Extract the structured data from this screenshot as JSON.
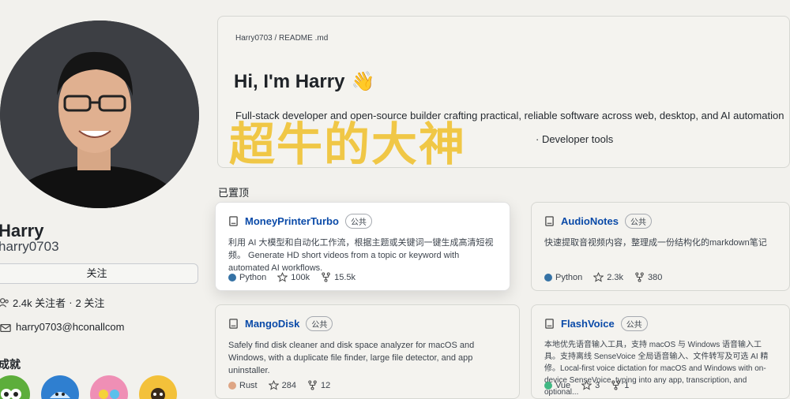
{
  "profile": {
    "name": "Harry",
    "login": "harry0703",
    "follow_label": "关注",
    "followers": "2.4k 关注者",
    "sep": "·",
    "following": "2 关注",
    "email": "harry0703@hconallcom",
    "achievements_title": "成就"
  },
  "readme": {
    "breadcrumb": "Harry0703 / README .md",
    "greeting": "Hi, I'm Harry",
    "greeting_emoji": "👋",
    "bio": "Full-stack developer and open-source builder crafting practical, reliable software across web, desktop, and AI automation",
    "extra": "· Developer tools"
  },
  "overlay_text": "超牛的大神",
  "pinned": {
    "title": "已置顶",
    "repos": [
      {
        "name": "MoneyPrinterTurbo",
        "visibility": "公共",
        "description": "利用 AI 大模型和自动化工作流，根据主题或关键词一键生成高清短视频。 Generate HD short videos from a topic or keyword with automated AI workflows.",
        "language": "Python",
        "lang_color": "#3572A5",
        "stars": "100k",
        "forks": "15.5k"
      },
      {
        "name": "AudioNotes",
        "visibility": "公共",
        "description": "快速提取音视频内容，整理成一份结构化的markdown笔记",
        "language": "Python",
        "lang_color": "#3572A5",
        "stars": "2.3k",
        "forks": "380"
      },
      {
        "name": "MangoDisk",
        "visibility": "公共",
        "description": "Safely find disk cleaner and disk space analyzer for macOS and Windows, with a duplicate file finder, large file detector, and app uninstaller.",
        "language": "Rust",
        "lang_color": "#dea584",
        "stars": "284",
        "forks": "12"
      },
      {
        "name": "FlashVoice",
        "visibility": "公共",
        "description": "本地优先语音输入工具，支持 macOS 与 Windows 语音输入工具。支持离线 SenseVoice 全局语音输入、文件转写及可选 AI 精修。Local-first voice dictation for macOS and Windows with on-device SenseVoice, typing into any app, transcription, and optional...",
        "language": "Vue",
        "lang_color": "#41b883",
        "stars": "3",
        "forks": "1"
      }
    ]
  },
  "colors": {
    "accent": "#0a4aa8",
    "overlay": "#f0c43a",
    "page_bg": "#f2f1ed"
  }
}
